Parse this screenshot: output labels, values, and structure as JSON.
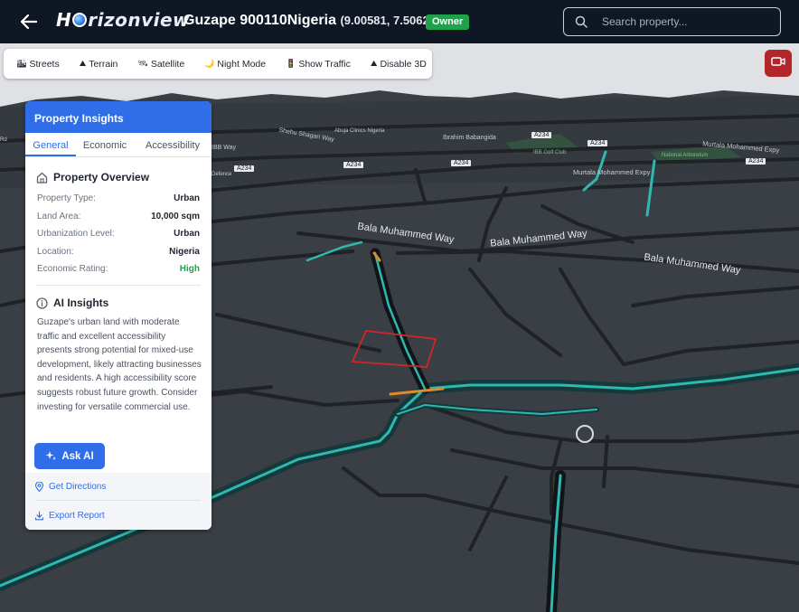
{
  "header": {
    "logo_left": "H",
    "logo_right": "rizonview",
    "title": "Guzape 900110Nigeria",
    "coords": "(9.00581, 7.5062)",
    "badge": "Owner",
    "search_placeholder": "Search property..."
  },
  "map_styles": [
    {
      "icon": "🏙",
      "label": "Streets"
    },
    {
      "icon": "⛰",
      "label": "Terrain"
    },
    {
      "icon": "🛰",
      "label": "Satellite"
    },
    {
      "icon": "🌙",
      "label": "Night Mode"
    },
    {
      "icon": "🚦",
      "label": "Show Traffic"
    },
    {
      "icon": "⛰",
      "label": "Disable 3D"
    }
  ],
  "panel": {
    "title": "Property Insights",
    "tabs": [
      "General",
      "Economic",
      "Accessibility"
    ],
    "overview_title": "Property Overview",
    "overview": [
      {
        "label": "Property Type:",
        "value": "Urban"
      },
      {
        "label": "Land Area:",
        "value": "10,000 sqm"
      },
      {
        "label": "Urbanization Level:",
        "value": "Urban"
      },
      {
        "label": "Location:",
        "value": "Nigeria"
      },
      {
        "label": "Economic Rating:",
        "value": "High"
      }
    ],
    "insights_title": "AI Insights",
    "insights_text": "Guzape's urban land with moderate traffic and excellent accessibility presents strong potential for mixed-use development, likely attracting businesses and residents. A high accessibility score suggests robust future growth. Consider investing for versatile commercial use.",
    "ask_ai": "Ask AI",
    "get_directions": "Get Directions",
    "export_report": "Export Report"
  },
  "map_labels": {
    "road_1": "Bala Muhammed Way",
    "road_2": "Bala Muhammed Way",
    "road_3": "Bala Muhammed Way",
    "shehu": "Shehu Shagari Way",
    "ibrahim": "Ibrahim Babangida",
    "murtala_1": "Murtala Mohammed Expy",
    "murtala_2": "Murtala Mohammed Expy",
    "ibb_way": "IBB Way",
    "abuja_clinics": "Abuja Clinics Nigeria",
    "ibb_golf": "IBB Golf Club",
    "national_arb": "National Arboretum",
    "defence": "Defence",
    "rd": "Rd",
    "a234": "A234"
  },
  "colors": {
    "accent": "#2f6de9",
    "positive": "#1fa34a",
    "record": "#b3262a",
    "road_teal": "#2fb8b0",
    "parcel": "#d0262a"
  }
}
